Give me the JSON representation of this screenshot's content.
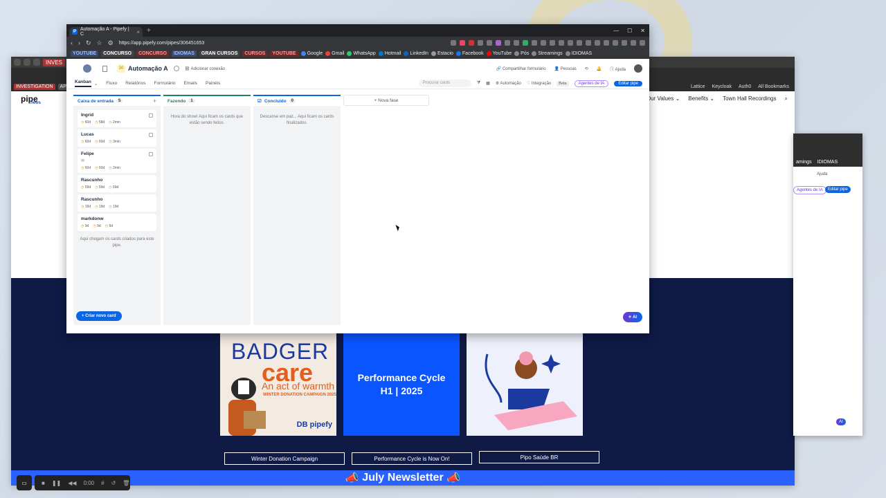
{
  "main_browser": {
    "tab_title": "Automação A - Pipefy | C",
    "url": "https://app.pipefy.com/pipes/306451653",
    "bookmarks_chips": [
      {
        "label": "YOUTUBE",
        "bg": "#3b4a6b",
        "fg": "#9fc0ff"
      },
      {
        "label": "CONCURSO",
        "bg": "#444",
        "fg": "#fff"
      },
      {
        "label": "CONCURSO",
        "bg": "#6b2a2a",
        "fg": "#ff9999"
      },
      {
        "label": "IDIOMAS",
        "bg": "#3b4a6b",
        "fg": "#9fc0ff"
      },
      {
        "label": "GRAN CURSOS",
        "bg": "#444",
        "fg": "#fff"
      },
      {
        "label": "CURSOS",
        "bg": "#6b2a2a",
        "fg": "#ff9999"
      },
      {
        "label": "YOUTUBE",
        "bg": "#6b2a2a",
        "fg": "#ff9999"
      }
    ],
    "bookmark_links": [
      "Google",
      "Gmail",
      "WhatsApp",
      "Hotmail",
      "LinkedIn",
      "Estacio",
      "Facebook",
      "YouTube",
      "Pós",
      "Streamings",
      "IDIOMAS"
    ]
  },
  "app": {
    "pipe_name": "Automação A",
    "add_connection": "Adicionar conexão",
    "share_form": "Compartilhar formulário",
    "people": "Pessoas",
    "help": "Ajuda",
    "nav_tabs": [
      "Kanban",
      "Fluxo",
      "Relatórios",
      "Formulário",
      "Emails",
      "Painéis"
    ],
    "search_placeholder": "Procurar cards",
    "automation": "Automação",
    "integration": "Integração",
    "beta": "Beta",
    "agents": "Agentes de IA",
    "edit_pipe": "Editar pipe",
    "new_card": "Criar novo card",
    "new_phase": "Nova fase",
    "ai": "AI"
  },
  "phases": [
    {
      "name": "Caixa de entrada",
      "count": "5",
      "color": "#0c66e4",
      "cards": [
        {
          "title": "Ingrid",
          "meta": [
            "60d",
            "58d",
            "2min"
          ]
        },
        {
          "title": "Lucas",
          "meta": [
            "60d",
            "60d",
            "3min"
          ]
        },
        {
          "title": "Felipe",
          "meta": [
            "60d",
            "60d",
            "2min"
          ]
        },
        {
          "title": "Rascunho",
          "meta": [
            "59d",
            "59d",
            "59d"
          ]
        },
        {
          "title": "Rascunho",
          "meta": [
            "19d",
            "19d",
            "19d"
          ]
        },
        {
          "title": "markdonw",
          "meta": [
            "9d",
            "9d",
            "9d"
          ]
        }
      ],
      "footer": "Aqui chegam os cards criados para este pipe."
    },
    {
      "name": "Fazendo",
      "count": "1",
      "color": "#1f845a",
      "empty": "Hora do show! Aqui ficam os cards que estão sendo feitos."
    },
    {
      "name": "Concluído",
      "count": "0",
      "color": "#0c66e4",
      "empty": "Descanse em paz... Aqui ficam os cards finalizados."
    }
  ],
  "background_page": {
    "logo": "pipe",
    "logo_sub": "news",
    "nav": [
      "Our Values ⌄",
      "Benefits ⌄",
      "Town Hall Recordings"
    ],
    "chips": [
      "INVESTIGATION",
      "APP"
    ],
    "top_chip": "INVES",
    "bm_right": [
      "Lattice",
      "Keycloak",
      "Auth0",
      "All Bookmarks"
    ],
    "tiles": [
      {
        "t1": "BADGER",
        "t2": "care",
        "t3": "An act of warmth",
        "t4": "WINTER DONATION CAMPAIGN 2025",
        "t5": "DB pipefy",
        "button": "Winter Donation Campaign"
      },
      {
        "text_line1": "Performance Cycle",
        "text_line2": "H1 | 2025",
        "button": "Performance Cycle is Now On!"
      },
      {
        "button": "Pipo Saúde BR"
      }
    ],
    "newsletter": "July Newsletter"
  },
  "right_window": {
    "bm": [
      "amings",
      "IDIOMAS"
    ],
    "help": "Ajuda",
    "agents": "Agentes de IA",
    "edit_pipe": "Editar pipe",
    "ai": "AI"
  },
  "recorder": {
    "time": "0:00"
  }
}
